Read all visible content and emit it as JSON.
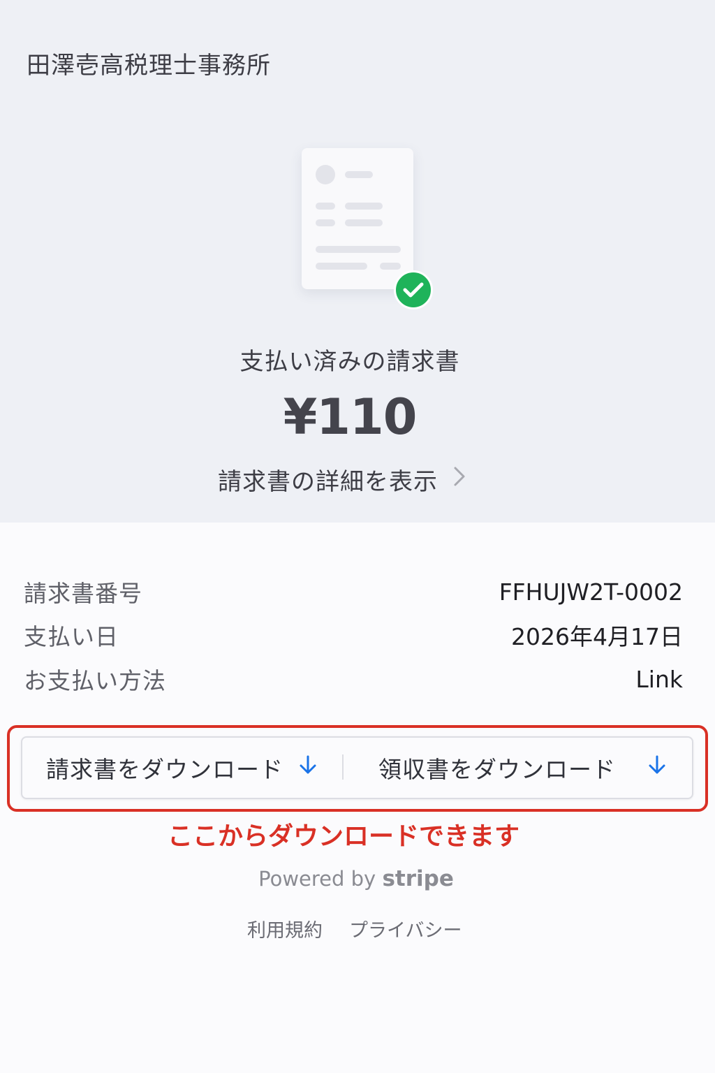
{
  "header": {
    "merchant_name": "田澤壱高税理士事務所"
  },
  "summary": {
    "status_label": "支払い済みの請求書",
    "amount": "¥110",
    "details_link": "請求書の詳細を表示",
    "status_icon": "check-icon",
    "status_color": "#1fb35a"
  },
  "details": {
    "rows": [
      {
        "label": "請求書番号",
        "value": "FFHUJW2T-0002"
      },
      {
        "label": "支払い日",
        "value": "2026年4月17日"
      },
      {
        "label": "お支払い方法",
        "value": "Link"
      }
    ]
  },
  "actions": {
    "download_invoice": "請求書をダウンロード",
    "download_receipt": "領収書をダウンロード",
    "download_icon": "arrow-down-icon",
    "accent": "#1a73e8"
  },
  "annotation": {
    "text": "ここからダウンロードできます",
    "color": "#d93025"
  },
  "footer": {
    "powered_prefix": "Powered by",
    "powered_brand": "stripe",
    "terms": "利用規約",
    "privacy": "プライバシー"
  }
}
